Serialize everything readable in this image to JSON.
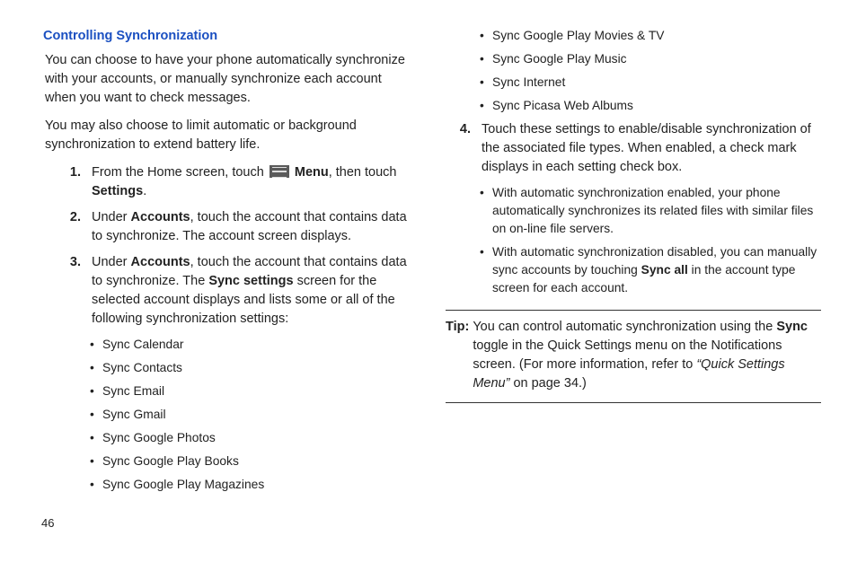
{
  "heading": "Controlling Synchronization",
  "para1": "You can choose to have your phone automatically synchronize with your accounts, or manually synchronize each account when you want to check messages.",
  "para2": "You may also choose to limit automatic or background synchronization to extend battery life.",
  "steps": {
    "s1": {
      "num": "1.",
      "pre": "From the Home screen, touch ",
      "menu": "Menu",
      "mid": ", then touch ",
      "settings": "Settings",
      "post": "."
    },
    "s2": {
      "num": "2.",
      "pre": "Under ",
      "accounts": "Accounts",
      "post": ", touch the account that contains data to synchronize. The account screen displays."
    },
    "s3": {
      "num": "3.",
      "pre": "Under ",
      "accounts": "Accounts",
      "mid1": ", touch the account that contains data to synchronize. The ",
      "sync": "Sync settings",
      "post": " screen for the selected account displays and lists some or all of the following synchronization settings:"
    },
    "s4": {
      "num": "4.",
      "text": "Touch these settings to enable/disable synchronization of the associated file types. When enabled, a check mark displays in each setting check box."
    }
  },
  "leftBullets": [
    "Sync Calendar",
    "Sync Contacts",
    "Sync Email",
    "Sync Gmail",
    "Sync Google Photos",
    "Sync Google Play Books",
    "Sync Google Play Magazines"
  ],
  "rightBullets": [
    "Sync Google Play Movies & TV",
    "Sync Google Play Music",
    "Sync Internet",
    "Sync Picasa Web Albums"
  ],
  "subBullets": {
    "b1": "With automatic synchronization enabled, your phone automatically synchronizes its related files with similar files on on-line file servers.",
    "b2pre": " With automatic synchronization disabled, you can manually sync accounts by touching ",
    "b2bold": "Sync all",
    "b2post": " in the account type screen for each account."
  },
  "tip": {
    "label": "Tip:",
    "pre": " You can control automatic synchronization using the ",
    "sync": "Sync",
    "mid": " toggle in the Quick Settings menu on the Notifications screen. (For more information, refer to ",
    "quick": "“Quick Settings Menu”",
    "post": " on page 34.)"
  },
  "pageNumber": "46"
}
